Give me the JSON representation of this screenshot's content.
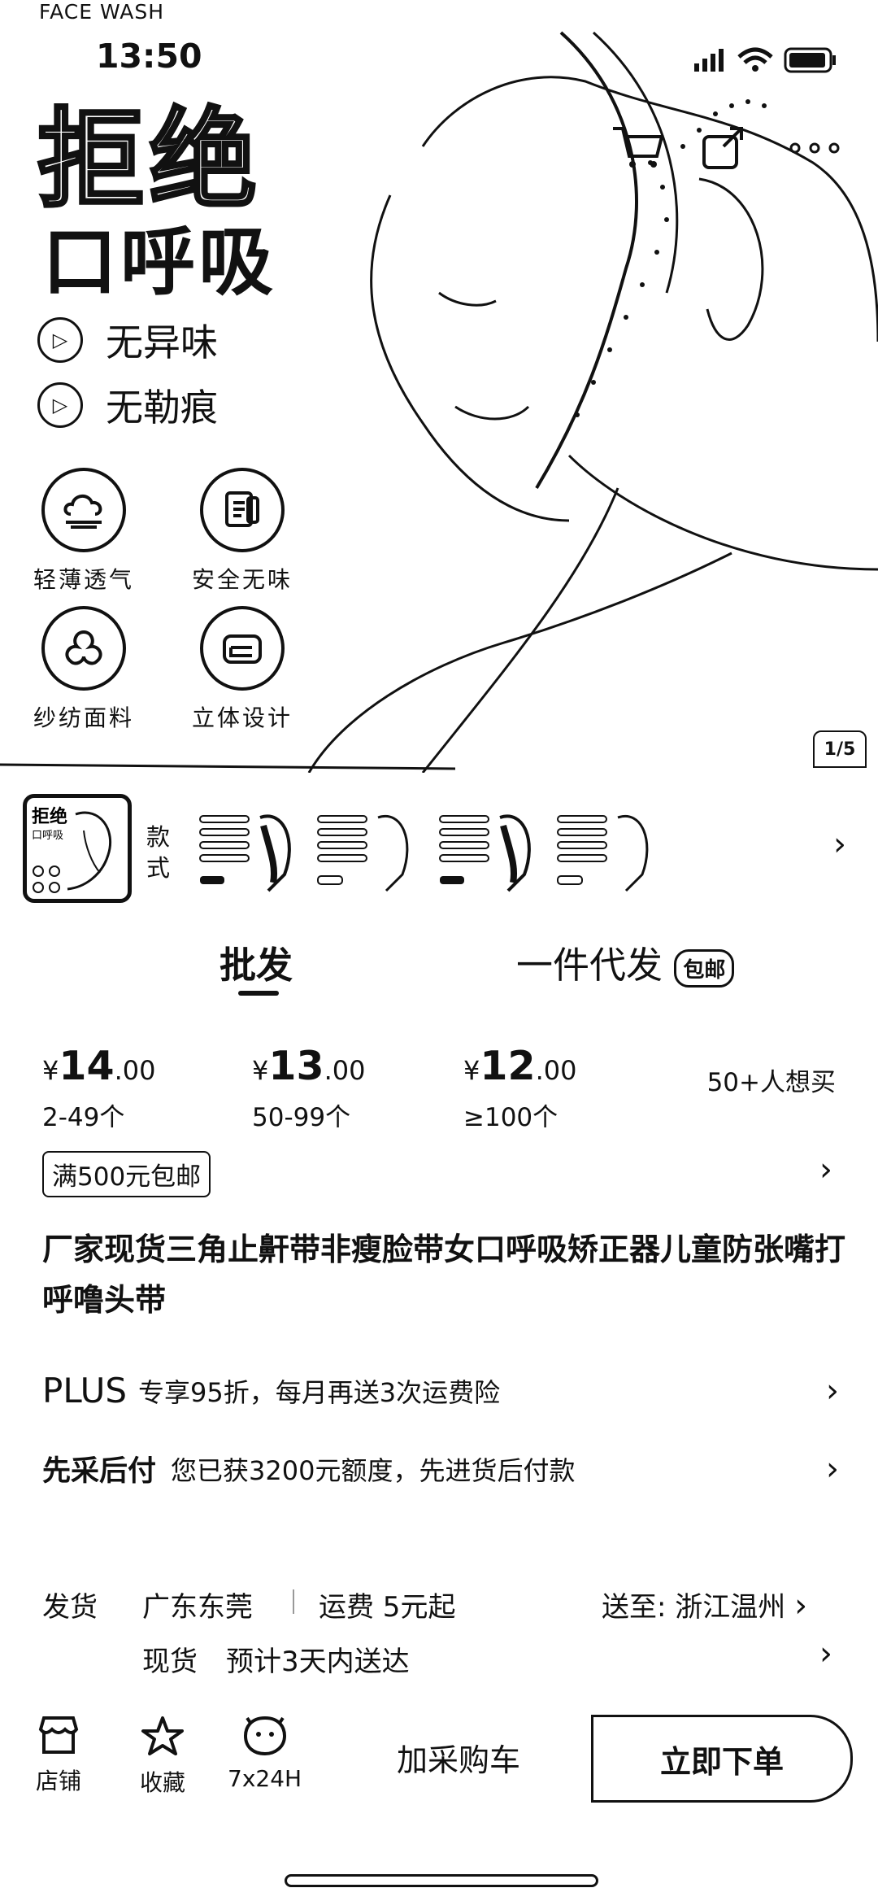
{
  "status": {
    "brand": "FACE WASH",
    "time": "13:50"
  },
  "hero": {
    "title_big": "拒绝",
    "title_sub": "口呼吸",
    "features": [
      "无异味",
      "无勒痕"
    ],
    "badges": [
      "轻薄透气",
      "安全无味",
      "纱纺面料",
      "立体设计"
    ],
    "counter": "1/5"
  },
  "styles": {
    "label": "款式"
  },
  "tabs": {
    "wholesale": "批发",
    "dropship": "一件代发",
    "dropship_tag": "包邮"
  },
  "prices": [
    {
      "currency": "¥",
      "int": "14",
      "dec": ".00",
      "range": "2-49个"
    },
    {
      "currency": "¥",
      "int": "13",
      "dec": ".00",
      "range": "50-99个"
    },
    {
      "currency": "¥",
      "int": "12",
      "dec": ".00",
      "range": "≥100个"
    }
  ],
  "want_buy": "50+人想买",
  "free_shipping": "满500元包邮",
  "product_title": "厂家现货三角止鼾带非瘦脸带女口呼吸矫正器儿童防张嘴打呼噜头带",
  "plus": {
    "label": "PLUS",
    "text": "专享95折，每月再送3次运费险"
  },
  "credit": {
    "label": "先采后付",
    "text": "您已获3200元额度，先进货后付款"
  },
  "shipping": {
    "label": "发货",
    "origin": "广东东莞",
    "fee": "运费 5元起",
    "dest_label": "送至:",
    "dest": "浙江温州",
    "stock": "现货",
    "eta": "预计3天内送达"
  },
  "bottom": {
    "shop": "店铺",
    "favorite": "收藏",
    "service": "7x24H",
    "add_cart": "加采购车",
    "buy_now": "立即下单"
  }
}
